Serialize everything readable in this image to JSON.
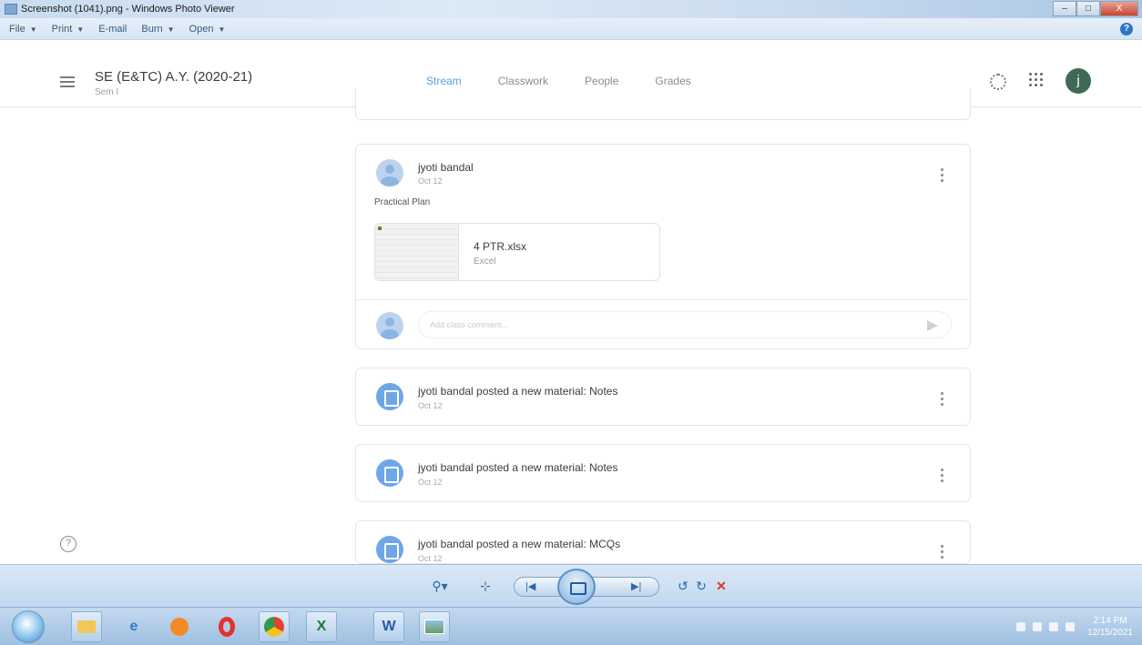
{
  "window": {
    "title": "Screenshot (1041).png - Windows Photo Viewer",
    "min": "–",
    "max": "□",
    "close": "X"
  },
  "menubar": {
    "items": [
      "File",
      "Print",
      "E-mail",
      "Burn",
      "Open"
    ],
    "help": "?"
  },
  "classroom": {
    "class_name": "SE (E&TC) A.Y. (2020-21)",
    "section": "Sem I",
    "tabs": [
      "Stream",
      "Classwork",
      "People",
      "Grades"
    ],
    "active_tab": "Stream",
    "avatar_initial": "j"
  },
  "post": {
    "author": "jyoti bandal",
    "date": "Oct 12",
    "text": "Practical Plan",
    "attachment": {
      "name": "4 PTR.xlsx",
      "type": "Excel"
    },
    "comment_placeholder": "Add class comment..."
  },
  "materials": [
    {
      "text": "jyoti bandal posted a new material: Notes",
      "date": "Oct 12"
    },
    {
      "text": "jyoti bandal posted a new material: Notes",
      "date": "Oct 12"
    },
    {
      "text": "jyoti bandal posted a new material: MCQs",
      "date": "Oct 12"
    }
  ],
  "help_glyph": "?",
  "viewer_controls": {
    "zoom": "⚲▾",
    "fit": "⊹",
    "prev": "|◀",
    "next": "▶|",
    "rotate_ccw": "↺",
    "rotate_cw": "↻",
    "delete": "✕"
  },
  "taskbar": {
    "apps": [
      "folder",
      "ie",
      "media",
      "opera",
      "chrome",
      "excel",
      "word",
      "photo"
    ],
    "clock_time": "2:14 PM",
    "clock_date": "12/15/2021"
  }
}
